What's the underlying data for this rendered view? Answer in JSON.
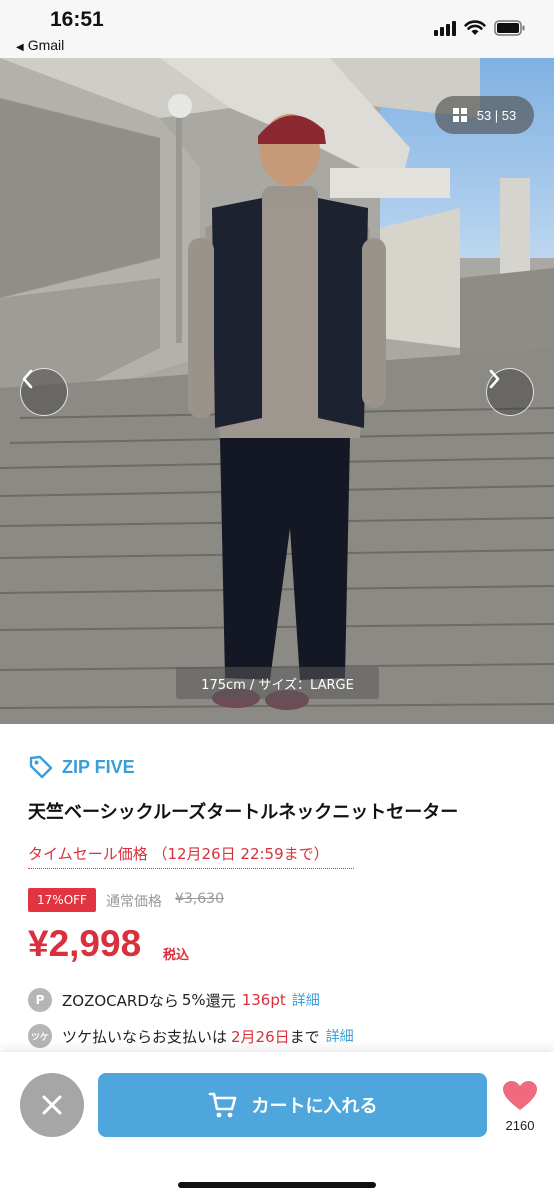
{
  "status_bar": {
    "time": "16:51",
    "back_app": "Gmail",
    "icons": [
      "signal-icon",
      "wifi-icon",
      "battery-icon"
    ]
  },
  "gallery": {
    "counter": "53 | 53",
    "caption": "175cm / サイズ：LARGE",
    "prev_icon": "chevron-left-icon",
    "next_icon": "chevron-right-icon"
  },
  "product": {
    "brand": "ZIP FIVE",
    "name": "天竺ベーシックルーズタートルネックニットセーター",
    "sale_label": "タイムセール価格 （12月26日 22:59まで）",
    "discount": "17%OFF",
    "regular_label": "通常価格",
    "regular_price": "¥3,630",
    "price": "¥2,998",
    "tax": "税込"
  },
  "zozocard": {
    "icon": "P",
    "text": "ZOZOCARDなら",
    "rate": "5%",
    "text2": "還元",
    "points": "136pt",
    "link": "詳細"
  },
  "tsuke": {
    "icon": "ツケ",
    "text": "ツケ払いならお支払いは",
    "date": "2月26日",
    "text2": "まで",
    "link": "詳細"
  },
  "actions": {
    "cart_label": "カートに入れる",
    "favorite_count": "2160"
  },
  "colors": {
    "accent_blue": "#4ea6dc",
    "sale_red": "#d9303d",
    "brand_blue": "#3b9ed9",
    "heart_pink": "#ef6a7d"
  }
}
